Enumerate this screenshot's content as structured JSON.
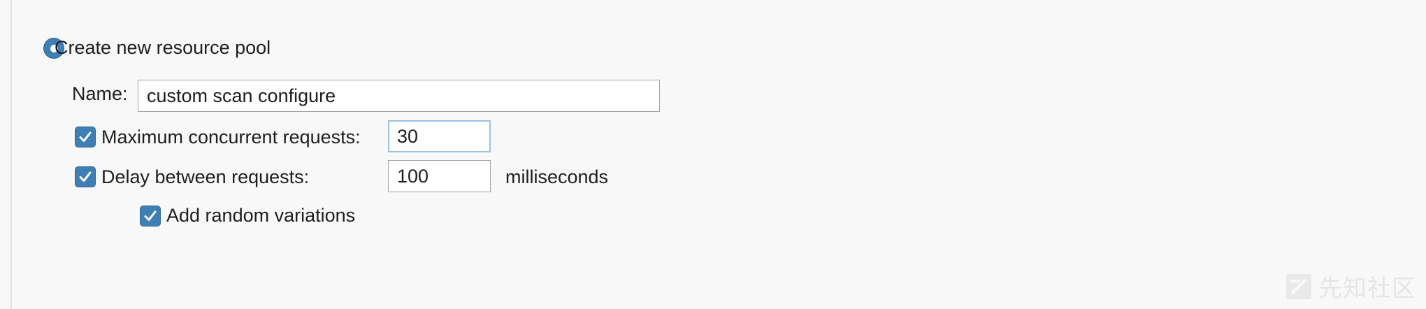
{
  "resource_pool": {
    "create_new_label": "Create new resource pool",
    "create_new_selected": true,
    "name_label": "Name:",
    "name_value": "custom scan configure",
    "max_concurrent": {
      "label": "Maximum concurrent requests:",
      "checked": true,
      "value": "30"
    },
    "delay": {
      "label": "Delay between requests:",
      "checked": true,
      "value": "100",
      "unit": "milliseconds"
    },
    "random_variations": {
      "label": "Add random variations",
      "checked": true
    }
  },
  "watermark": {
    "text": "先知社区"
  },
  "colors": {
    "accent": "#3f7fb4",
    "background": "#f8f8f8",
    "focus_border": "#9cc2e2",
    "input_border": "#a4a4a4"
  },
  "icons": [
    "radio-selected",
    "checkmark-icon",
    "watermark-logo-icon"
  ]
}
